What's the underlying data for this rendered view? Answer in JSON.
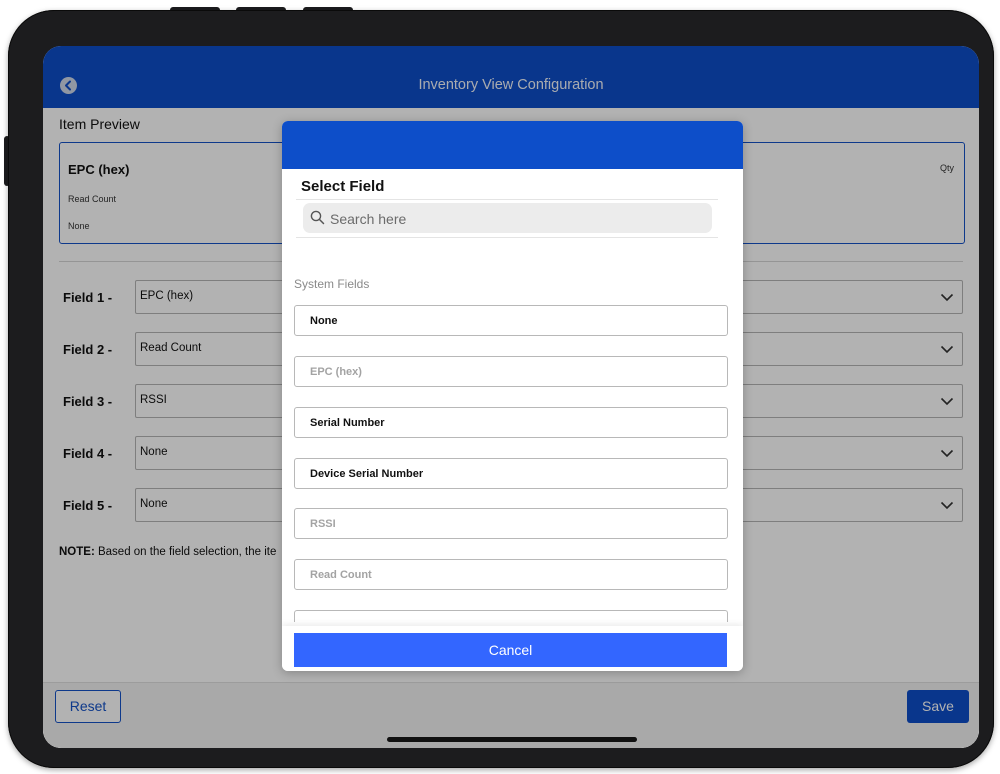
{
  "app": {
    "title": "Inventory View Configuration"
  },
  "preview": {
    "section_title": "Item Preview",
    "primary": "EPC (hex)",
    "secondary": "Read Count",
    "tertiary": "None",
    "right": "Qty"
  },
  "fields": [
    {
      "label": "Field  1 -",
      "value": "EPC (hex)"
    },
    {
      "label": "Field  2 -",
      "value": "Read Count"
    },
    {
      "label": "Field  3 -",
      "value": "RSSI"
    },
    {
      "label": "Field  4 -",
      "value": "None"
    },
    {
      "label": "Field  5 -",
      "value": "None"
    }
  ],
  "note": {
    "prefix": "NOTE:",
    "text": " Based on the field selection, the ite"
  },
  "footer": {
    "reset_label": "Reset",
    "save_label": "Save"
  },
  "modal": {
    "title": "Select Field",
    "search_placeholder": "Search here",
    "group_label": "System Fields",
    "options": [
      {
        "label": "None",
        "enabled": true
      },
      {
        "label": "EPC (hex)",
        "enabled": false
      },
      {
        "label": "Serial Number",
        "enabled": true
      },
      {
        "label": "Device Serial Number",
        "enabled": true
      },
      {
        "label": "RSSI",
        "enabled": false
      },
      {
        "label": "Read Count",
        "enabled": false
      }
    ],
    "cancel_label": "Cancel"
  },
  "colors": {
    "primary_blue": "#0d4ec9",
    "cancel_blue": "#3366ff",
    "disabled_text": "#a3a3a3"
  }
}
